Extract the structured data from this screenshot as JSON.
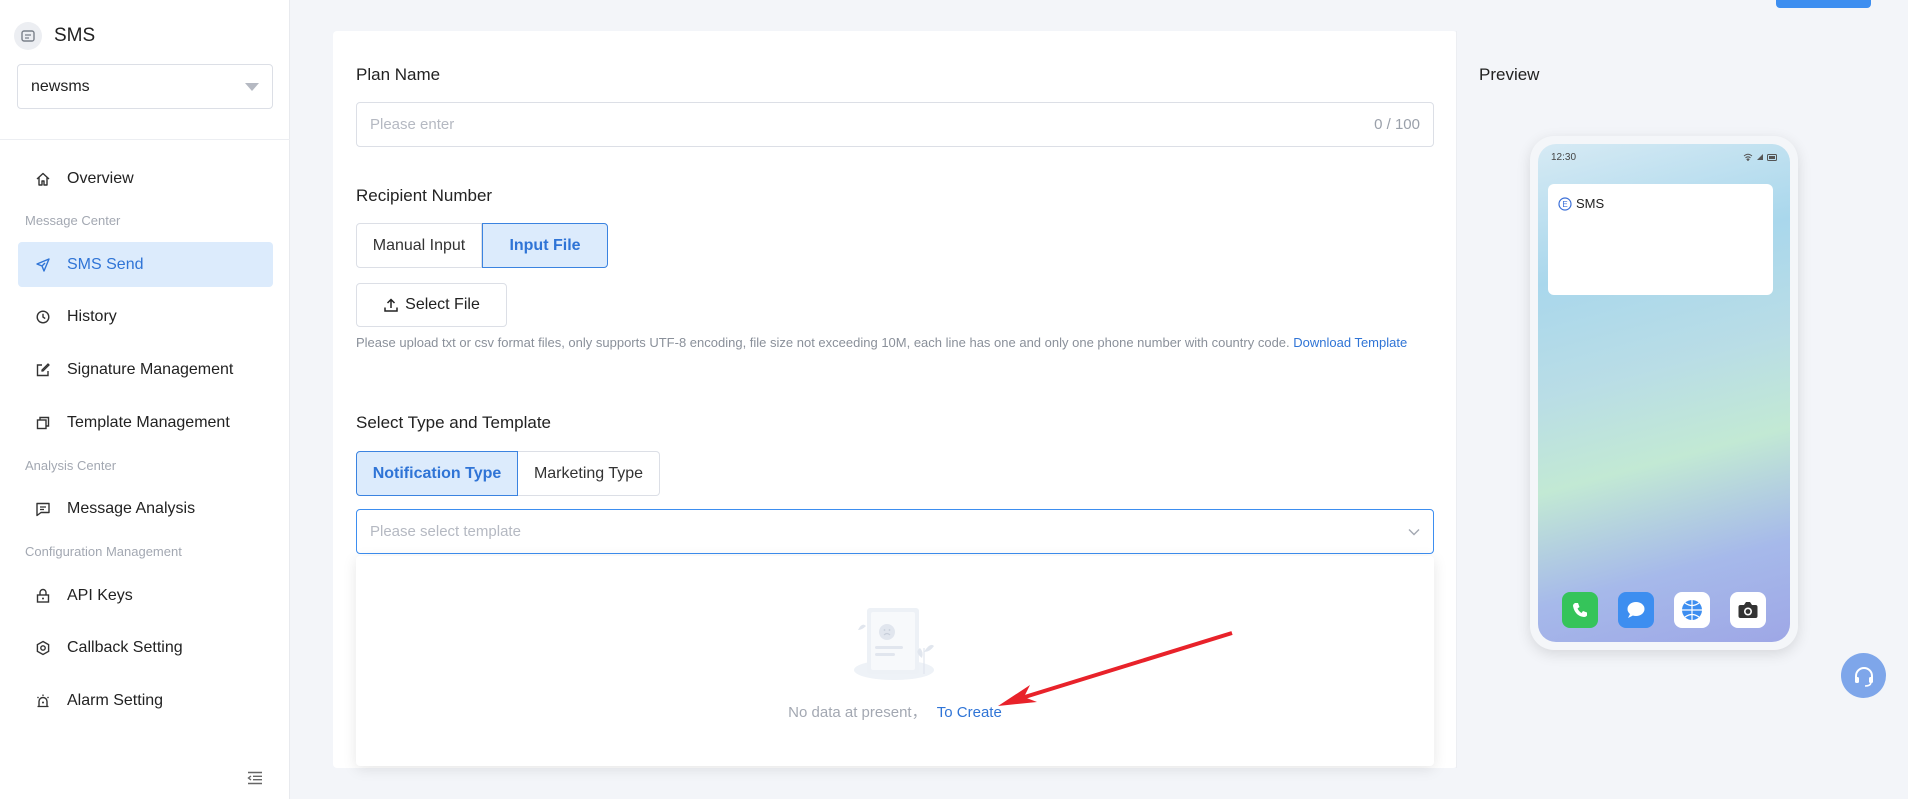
{
  "sidebar": {
    "brand_title": "SMS",
    "workspace": "newsms",
    "overview": "Overview",
    "section_message": "Message Center",
    "sms_send": "SMS Send",
    "history": "History",
    "signature": "Signature Management",
    "template": "Template Management",
    "section_analysis": "Analysis Center",
    "message_analysis": "Message Analysis",
    "section_config": "Configuration Management",
    "api_keys": "API Keys",
    "callback": "Callback Setting",
    "alarm": "Alarm Setting"
  },
  "form": {
    "plan_name_label": "Plan Name",
    "plan_name_placeholder": "Please enter",
    "plan_name_counter": "0 / 100",
    "recipient_label": "Recipient Number",
    "manual_input": "Manual Input",
    "input_file": "Input File",
    "select_file": "Select File",
    "upload_hint": "Please upload txt or csv format files, only supports UTF-8 encoding, file size not exceeding 10M, each line has one and only one phone number with country code.",
    "download_template": "Download Template",
    "type_label": "Select Type and Template",
    "notification_type": "Notification Type",
    "marketing_type": "Marketing Type",
    "template_placeholder": "Please select template",
    "empty_text": "No data at present，",
    "to_create": "To Create"
  },
  "preview": {
    "title": "Preview",
    "time": "12:30",
    "sms_header": "SMS"
  },
  "colors": {
    "accent": "#2f74d6",
    "active_bg": "#dcebfc",
    "arrow": "#e8222a"
  }
}
